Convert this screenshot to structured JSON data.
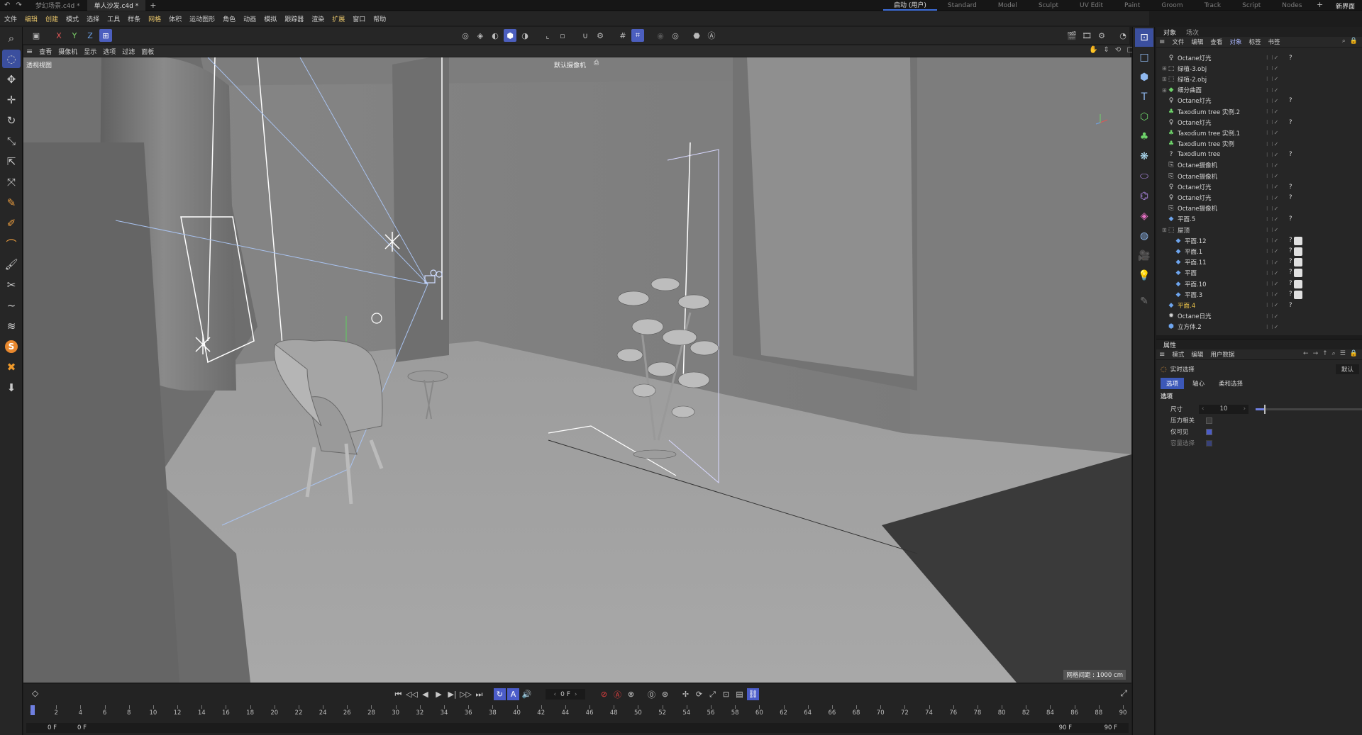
{
  "titlebar": {
    "file_tabs": [
      {
        "label": "梦幻场景.c4d *",
        "active": false
      },
      {
        "label": "单人沙发.c4d *",
        "active": true
      }
    ],
    "add_tab": "+",
    "layouts": [
      {
        "label": "启动 (用户)",
        "active": true
      },
      {
        "label": "Standard"
      },
      {
        "label": "Model"
      },
      {
        "label": "Sculpt"
      },
      {
        "label": "UV Edit"
      },
      {
        "label": "Paint"
      },
      {
        "label": "Groom"
      },
      {
        "label": "Track"
      },
      {
        "label": "Script"
      },
      {
        "label": "Nodes"
      }
    ],
    "add_layout": "+",
    "new_layout": "新界面"
  },
  "menubar": [
    "文件",
    "编辑",
    "创建",
    "模式",
    "选择",
    "工具",
    "样条",
    "网格",
    "体积",
    "运动图形",
    "角色",
    "动画",
    "模拟",
    "跟踪器",
    "渲染",
    "扩展",
    "窗口",
    "帮助"
  ],
  "axis": {
    "x": "X",
    "y": "Y",
    "z": "Z"
  },
  "viewport": {
    "menu": [
      "查看",
      "摄像机",
      "显示",
      "选项",
      "过滤",
      "面板"
    ],
    "view_name": "透视视图",
    "camera_name": "默认摄像机",
    "grid_spacing": "网格间距 : 1000 cm"
  },
  "timeline": {
    "current_frame": "0 F",
    "start_frame": "0 F",
    "start_frame_2": "0 F",
    "end_frame": "90 F",
    "end_frame_2": "90 F",
    "ticks": [
      "0",
      "2",
      "4",
      "6",
      "8",
      "10",
      "12",
      "14",
      "16",
      "18",
      "20",
      "22",
      "24",
      "26",
      "28",
      "30",
      "32",
      "34",
      "36",
      "38",
      "40",
      "42",
      "44",
      "46",
      "48",
      "50",
      "52",
      "54",
      "56",
      "58",
      "60",
      "62",
      "64",
      "66",
      "68",
      "70",
      "72",
      "74",
      "76",
      "78",
      "80",
      "82",
      "84",
      "86",
      "88",
      "90"
    ]
  },
  "objects_panel": {
    "tabs": [
      {
        "label": "对象",
        "active": true
      },
      {
        "label": "场次"
      }
    ],
    "menu": [
      "文件",
      "编辑",
      "查看",
      "对象",
      "标签",
      "书签"
    ],
    "active_menu": "对象",
    "items": [
      {
        "name": "Octane灯光",
        "icon": "light-icon",
        "indent": 0
      },
      {
        "name": "绿植-3.obj",
        "icon": "null-icon",
        "indent": 0,
        "expandable": true
      },
      {
        "name": "绿植-2.obj",
        "icon": "null-icon",
        "indent": 0,
        "expandable": true
      },
      {
        "name": "细分曲面",
        "icon": "subdivision-icon",
        "indent": 0,
        "expandable": true
      },
      {
        "name": "Octane灯光",
        "icon": "light-icon",
        "indent": 0
      },
      {
        "name": "Taxodium tree 实例.2",
        "icon": "instance-icon",
        "indent": 0
      },
      {
        "name": "Octane灯光",
        "icon": "light-icon",
        "indent": 0
      },
      {
        "name": "Taxodium tree 实例.1",
        "icon": "instance-icon",
        "indent": 0
      },
      {
        "name": "Taxodium tree 实例",
        "icon": "instance-icon",
        "indent": 0
      },
      {
        "name": "Taxodium tree",
        "icon": "unknown-icon",
        "indent": 0
      },
      {
        "name": "Octane摄像机",
        "icon": "camera-icon",
        "indent": 0
      },
      {
        "name": "Octane摄像机",
        "icon": "camera-icon",
        "indent": 0
      },
      {
        "name": "Octane灯光",
        "icon": "light-icon",
        "indent": 0
      },
      {
        "name": "Octane灯光",
        "icon": "light-icon",
        "indent": 0
      },
      {
        "name": "Octane摄像机",
        "icon": "camera-icon",
        "indent": 0
      },
      {
        "name": "平面.5",
        "icon": "plane-icon",
        "indent": 0
      },
      {
        "name": "屋顶",
        "icon": "null-icon",
        "indent": 0,
        "expandable": true
      },
      {
        "name": "平面.12",
        "icon": "plane-icon",
        "indent": 1
      },
      {
        "name": "平面.1",
        "icon": "plane-icon",
        "indent": 1
      },
      {
        "name": "平面.11",
        "icon": "plane-icon",
        "indent": 1
      },
      {
        "name": "平面",
        "icon": "plane-icon",
        "indent": 1
      },
      {
        "name": "平面.10",
        "icon": "plane-icon",
        "indent": 1
      },
      {
        "name": "平面.3",
        "icon": "plane-icon",
        "indent": 1
      },
      {
        "name": "平面.4",
        "icon": "plane-icon",
        "indent": 0,
        "selected": true
      },
      {
        "name": "Octane日光",
        "icon": "sun-icon",
        "indent": 0
      },
      {
        "name": "立方体.2",
        "icon": "cube-icon",
        "indent": 0
      }
    ]
  },
  "attributes_panel": {
    "tabs": [
      {
        "label": "属性",
        "active": true
      }
    ],
    "menu": [
      "模式",
      "编辑",
      "用户数据"
    ],
    "tool_name": "实时选择",
    "preset": "默认",
    "subtabs": [
      {
        "label": "选项",
        "active": true
      },
      {
        "label": "轴心"
      },
      {
        "label": "柔和选择"
      }
    ],
    "section": "选项",
    "size_label": "尺寸",
    "size_value": "10",
    "pressure_label": "压力相关",
    "visible_label": "仅可见",
    "visible_checked": true,
    "hidden_label": "容量选择"
  }
}
